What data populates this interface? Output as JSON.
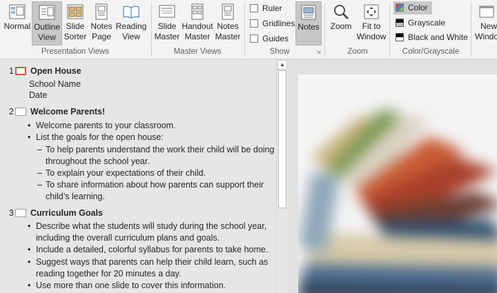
{
  "ribbon": {
    "presentation_views": {
      "label": "Presentation Views",
      "buttons": [
        {
          "line1": "Normal",
          "line2": ""
        },
        {
          "line1": "Outline",
          "line2": "View"
        },
        {
          "line1": "Slide",
          "line2": "Sorter"
        },
        {
          "line1": "Notes",
          "line2": "Page"
        },
        {
          "line1": "Reading",
          "line2": "View"
        }
      ]
    },
    "master_views": {
      "label": "Master Views",
      "buttons": [
        {
          "line1": "Slide",
          "line2": "Master"
        },
        {
          "line1": "Handout",
          "line2": "Master"
        },
        {
          "line1": "Notes",
          "line2": "Master"
        }
      ]
    },
    "show": {
      "label": "Show",
      "checks": [
        "Ruler",
        "Gridlines",
        "Guides"
      ],
      "notes_button": "Notes"
    },
    "zoom": {
      "label": "Zoom",
      "zoom_button": "Zoom",
      "fit_line1": "Fit to",
      "fit_line2": "Window"
    },
    "color_grayscale": {
      "label": "Color/Grayscale",
      "options": [
        "Color",
        "Grayscale",
        "Black and White"
      ]
    },
    "window": {
      "line1": "New",
      "line2": "Window"
    },
    "colors": {
      "accent": "#d0593f",
      "ribbon_bg": "#f3f3f3",
      "outline_bg": "#e6e6e6"
    }
  },
  "outline": {
    "slides": [
      {
        "num": "1",
        "title": "Open House",
        "subtitle": [
          "School Name",
          "Date"
        ]
      },
      {
        "num": "2",
        "title": "Welcome Parents!",
        "bullets": [
          "Welcome parents to your classroom.",
          "List the goals for the open house:"
        ],
        "subbullets": [
          "To help parents understand the work their child will be doing throughout the school year.",
          "To explain your expectations of their child.",
          "To share information about how parents can support their child’s learning."
        ]
      },
      {
        "num": "3",
        "title": "Curriculum Goals",
        "bullets": [
          "Describe what the students will study during the school year, including the overall curriculum plans and goals.",
          "Include a detailed, colorful syllabus for parents to take home.",
          "Suggest ways that parents can help their child learn, such as reading together for 20 minutes a day.",
          "Use more than one slide to cover this information."
        ]
      }
    ]
  }
}
